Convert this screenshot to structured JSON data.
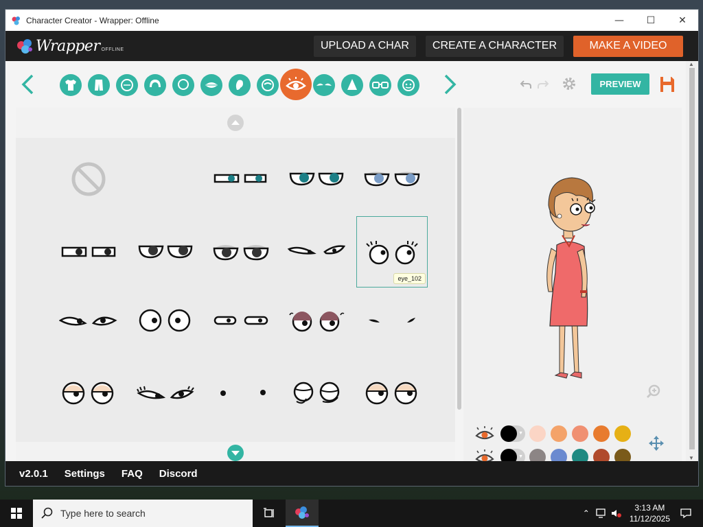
{
  "window": {
    "title": "Character Creator - Wrapper: Offline",
    "minimize": "—",
    "maximize": "☐",
    "close": "✕"
  },
  "nav": {
    "logo_text": "Wrapper",
    "logo_sub": "OFFLINE",
    "upload_label": "UPLOAD A CHAR",
    "create_label": "CREATE A CHARACTER",
    "video_label": "MAKE A VIDEO"
  },
  "toolbar": {
    "categories": [
      "upper-body",
      "lower-body",
      "face-shape",
      "hair",
      "mouth",
      "lips",
      "ear",
      "eyebrows",
      "eyes",
      "glasses-brow",
      "nose",
      "glasses",
      "facial-detail"
    ],
    "active_category": "eyes",
    "preview_label": "PREVIEW"
  },
  "grid": {
    "selected_item": "eye_102",
    "items": [
      "none",
      "eye_rect_teal",
      "eye_round_teal",
      "eye_round_blue",
      "eye_rect_plain",
      "eye_round_dark",
      "eye_lidded_dark",
      "eye_narrow",
      "eye_102",
      "eye_almond",
      "eye_wide",
      "eye_slit",
      "eye_brown_lid",
      "eye_tiny_marks",
      "eye_peach_lid",
      "eye_lashes",
      "eye_dot",
      "eye_spiral",
      "eye_sleepy"
    ]
  },
  "colors": {
    "row1": [
      "#000000",
      "#fbd5c5",
      "#f4a36a",
      "#f09072",
      "#e87b2e",
      "#e6b015"
    ],
    "row2": [
      "#000000",
      "#8c8585",
      "#6a8ad0",
      "#1f8a82",
      "#b04a2c",
      "#7a5a1a"
    ],
    "accent_teal": "#33b5a3",
    "accent_orange": "#e0622a"
  },
  "footer": {
    "version": "v2.0.1",
    "settings": "Settings",
    "faq": "FAQ",
    "discord": "Discord"
  },
  "taskbar": {
    "search_placeholder": "Type here to search",
    "time": "3:13 AM",
    "date": "11/12/2025"
  }
}
